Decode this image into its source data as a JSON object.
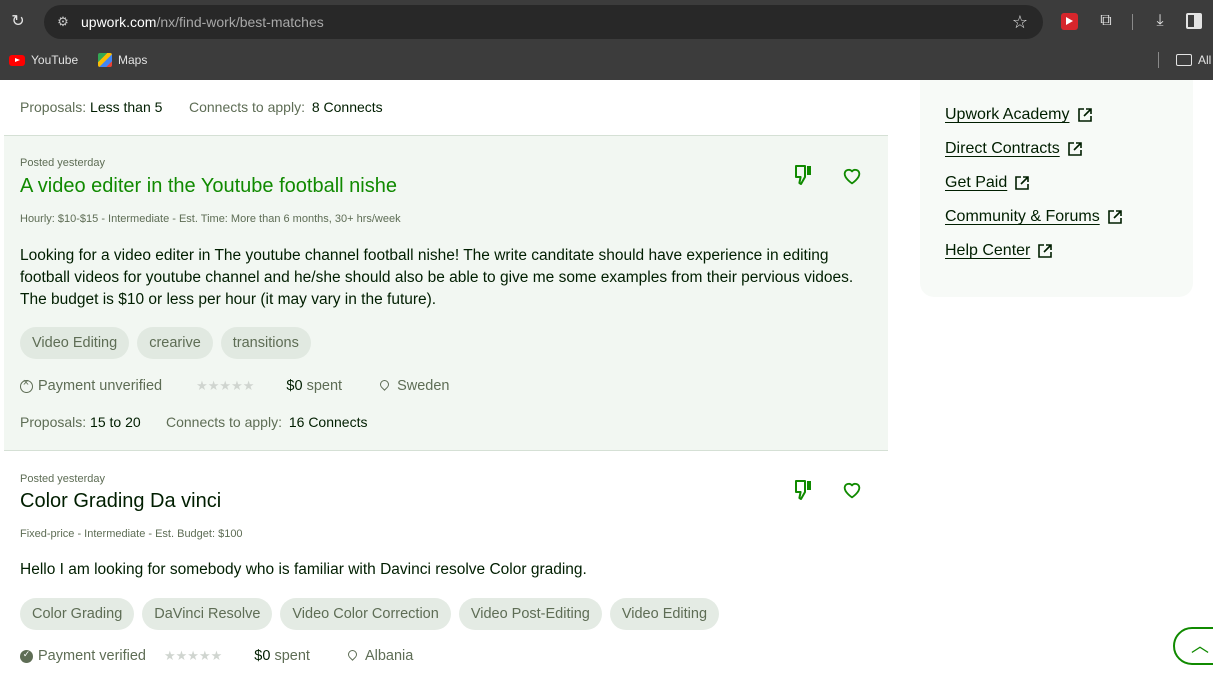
{
  "browser": {
    "url_host": "upwork.com",
    "url_path": "/nx/find-work/best-matches",
    "bookmarks": [
      {
        "label": "YouTube"
      },
      {
        "label": "Maps"
      }
    ],
    "all_bookmarks_label": "All"
  },
  "top_job": {
    "proposals_label": "Proposals:",
    "proposals_value": "Less than 5",
    "connects_label": "Connects to apply:",
    "connects_value": "8 Connects"
  },
  "jobs": [
    {
      "posted": "Posted yesterday",
      "title": "A video editer in the Youtube football nishe",
      "terms": "Hourly: $10-$15 - Intermediate - Est. Time: More than 6 months, 30+ hrs/week",
      "description": "Looking for a video editer in The youtube channel football nishe! The write canditate should have experience in editing football videos for youtube channel and he/she should also be able to give me some examples from their pervious vidoes. The budget is $10 or less per hour (it may vary in the future).",
      "tags": [
        "Video Editing",
        "crearive",
        "transitions"
      ],
      "payment": "Payment unverified",
      "spent_value": "$0",
      "spent_label": "spent",
      "location": "Sweden",
      "proposals_label": "Proposals:",
      "proposals_value": "15 to 20",
      "connects_label": "Connects to apply:",
      "connects_value": "16 Connects"
    },
    {
      "posted": "Posted yesterday",
      "title": "Color Grading Da vinci",
      "terms": "Fixed-price - Intermediate - Est. Budget: $100",
      "description": "Hello I am looking for somebody who is familiar with Davinci resolve Color grading.",
      "tags": [
        "Color Grading",
        "DaVinci Resolve",
        "Video Color Correction",
        "Video Post-Editing",
        "Video Editing"
      ],
      "payment": "Payment verified",
      "spent_value": "$0",
      "spent_label": "spent",
      "location": "Albania"
    }
  ],
  "sidebar": {
    "links": [
      {
        "label": "Upwork Academy"
      },
      {
        "label": "Direct Contracts"
      },
      {
        "label": "Get Paid"
      },
      {
        "label": "Community & Forums"
      },
      {
        "label": "Help Center"
      }
    ]
  },
  "colors": {
    "brand_green": "#108a00",
    "text_dark": "#001e00",
    "text_muted": "#5e6d55"
  }
}
